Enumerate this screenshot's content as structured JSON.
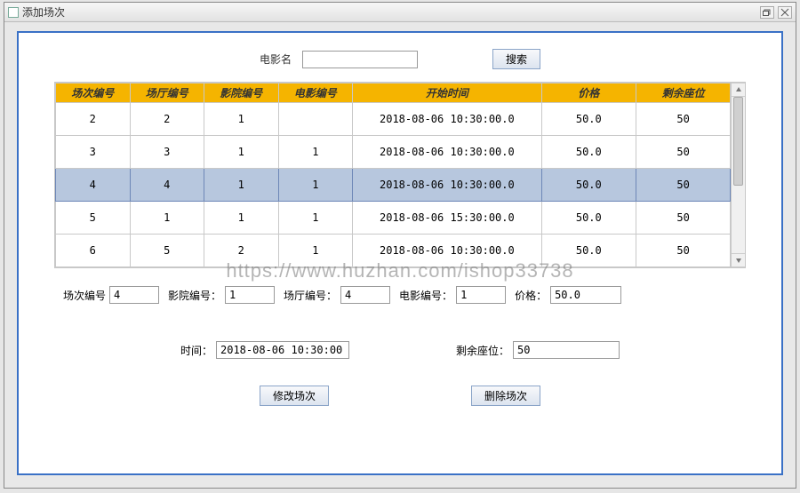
{
  "window": {
    "title": "添加场次"
  },
  "search": {
    "label": "电影名",
    "value": "",
    "button": "搜索"
  },
  "table": {
    "headers": [
      "场次编号",
      "场厅编号",
      "影院编号",
      "电影编号",
      "开始时间",
      "价格",
      "剩余座位"
    ],
    "rows": [
      {
        "cells": [
          "2",
          "2",
          "1",
          "",
          "2018-08-06 10:30:00.0",
          "50.0",
          "50"
        ],
        "selected": false
      },
      {
        "cells": [
          "3",
          "3",
          "1",
          "1",
          "2018-08-06 10:30:00.0",
          "50.0",
          "50"
        ],
        "selected": false
      },
      {
        "cells": [
          "4",
          "4",
          "1",
          "1",
          "2018-08-06 10:30:00.0",
          "50.0",
          "50"
        ],
        "selected": true
      },
      {
        "cells": [
          "5",
          "1",
          "1",
          "1",
          "2018-08-06 15:30:00.0",
          "50.0",
          "50"
        ],
        "selected": false
      },
      {
        "cells": [
          "6",
          "5",
          "2",
          "1",
          "2018-08-06 10:30:00.0",
          "50.0",
          "50"
        ],
        "selected": false
      }
    ]
  },
  "form": {
    "session_label": "场次编号",
    "session_value": "4",
    "cinema_label": "影院编号：",
    "cinema_value": "1",
    "hall_label": "场厅编号：",
    "hall_value": "4",
    "movie_label": "电影编号：",
    "movie_value": "1",
    "price_label": "价格：",
    "price_value": "50.0",
    "time_label": "时间：",
    "time_value": "2018-08-06 10:30:00",
    "seats_label": "剩余座位：",
    "seats_value": "50"
  },
  "buttons": {
    "modify": "修改场次",
    "delete": "删除场次"
  },
  "watermark": "https://www.huzhan.com/ishop33738"
}
